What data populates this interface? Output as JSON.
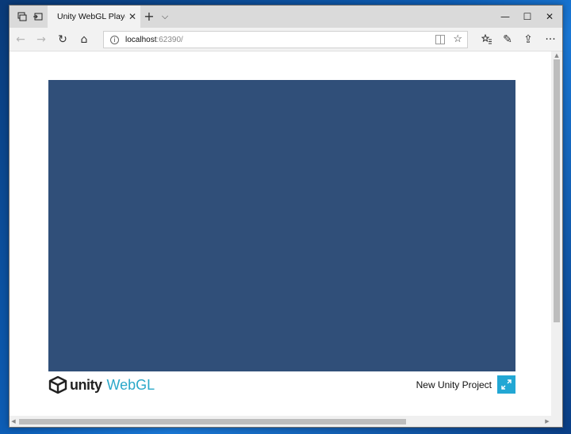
{
  "browser": {
    "tab": {
      "title": "Unity WebGL Player | Ne",
      "close_label": "✕"
    },
    "newtab_label": "+",
    "tabs_dropdown_label": "⌵",
    "window_controls": {
      "minimize": "—",
      "maximize": "☐",
      "close": "✕"
    },
    "address": {
      "host": "localhost",
      "rest": ":62390/"
    },
    "nav": {
      "back": "←",
      "forward": "→",
      "refresh": "↻",
      "home": "⌂"
    },
    "toolbar": {
      "favorites": "☆",
      "hub": "☆≡",
      "notes": "✎",
      "share": "⇪",
      "more": "···"
    }
  },
  "page": {
    "canvas_color": "#304f79",
    "logo": {
      "word": "unity",
      "product": "WebGL"
    },
    "project_title": "New Unity Project",
    "fullscreen_color": "#22a7d4"
  }
}
